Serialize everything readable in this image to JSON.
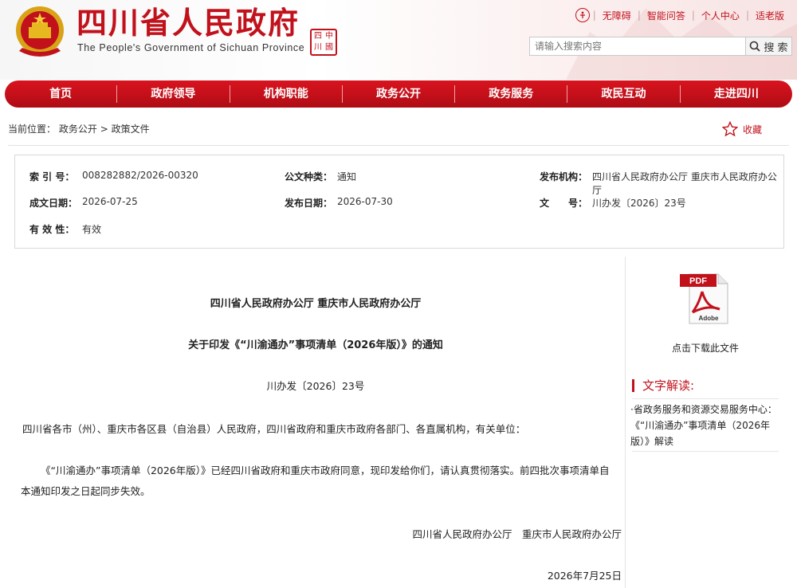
{
  "header": {
    "site_title": "四川省人民政府",
    "site_subtitle": "The People's Government of Sichuan Province",
    "seal_text": "中國四川",
    "top_links": [
      "无障碍",
      "智能问答",
      "个人中心",
      "适老版"
    ],
    "search_placeholder": "请输入搜索内容",
    "search_button": "搜 索"
  },
  "nav": {
    "items": [
      "首页",
      "政府领导",
      "机构职能",
      "政务公开",
      "政务服务",
      "政民互动",
      "走进四川"
    ]
  },
  "breadcrumb": {
    "prefix": "当前位置：",
    "items": [
      "政务公开",
      "政策文件"
    ],
    "separator": ">",
    "favorite": "收藏"
  },
  "meta": {
    "index_label": "索 引 号：",
    "index_value": "008282882/2026-00320",
    "doc_type_label": "公文种类：",
    "doc_type_value": "通知",
    "publisher_label": "发布机构：",
    "publisher_value": "四川省人民政府办公厅 重庆市人民政府办公厅",
    "created_label": "成文日期：",
    "created_value": "2026-07-25",
    "published_label": "发布日期：",
    "published_value": "2026-07-30",
    "docno_label": "文　　号：",
    "docno_value": "川办发〔2026〕23号",
    "validity_label": "有 效 性：",
    "validity_value": "有效"
  },
  "document": {
    "issuer": "四川省人民政府办公厅 重庆市人民政府办公厅",
    "title": "关于印发《“川渝通办”事项清单（2026年版）》的通知",
    "number": "川办发〔2026〕23号",
    "salutation": "四川省各市（州）、重庆市各区县（自治县）人民政府，四川省政府和重庆市政府各部门、各直属机构，有关单位：",
    "body": "《“川渝通办”事项清单（2026年版）》已经四川省政府和重庆市政府同意，现印发给你们，请认真贯彻落实。前四批次事项清单自本通知印发之日起同步失效。",
    "signature": "四川省人民政府办公厅　重庆市人民政府办公厅",
    "date": "2026年7月25日"
  },
  "sidebar": {
    "pdf_label": "PDF",
    "adobe_label": "Adobe",
    "download_text": "点击下载此文件",
    "interpretation_title": "文字解读:",
    "interpretation_link": "·省政务服务和资源交易服务中心：《“川渝通办”事项清单（2026年版）》解读"
  },
  "colors": {
    "brand_red": "#c1121c",
    "nav_red": "#d8141f"
  }
}
